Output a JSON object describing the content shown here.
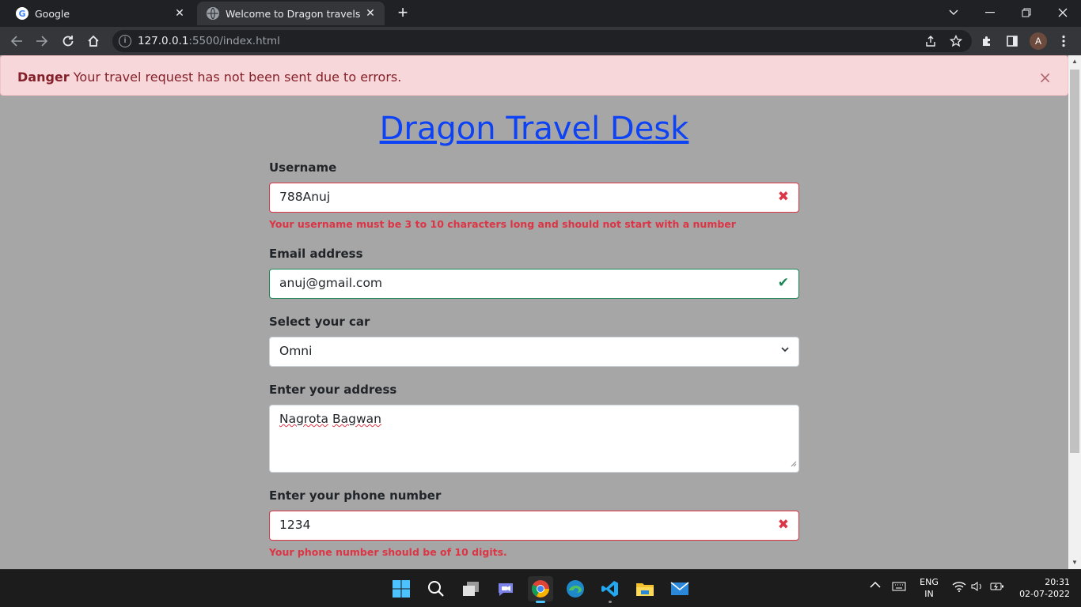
{
  "browser": {
    "tabs": [
      {
        "title": "Google",
        "favicon": "G"
      },
      {
        "title": "Welcome to Dragon travels",
        "favicon": "globe"
      }
    ],
    "tab_close": "✕",
    "new_tab": "+",
    "url_host": "127.0.0.1",
    "url_rest": ":5500/index.html",
    "profile_initial": "A"
  },
  "alert": {
    "strong": "Danger",
    "message": " Your travel request has not been sent due to errors.",
    "close": "×"
  },
  "page": {
    "heading": "Dragon Travel Desk",
    "username": {
      "label": "Username",
      "value": "788Anuj",
      "state": "✖",
      "feedback": "Your username must be 3 to 10 characters long and should not start with a number"
    },
    "email": {
      "label": "Email address",
      "value": "anuj@gmail.com",
      "state": "✔"
    },
    "car": {
      "label": "Select your car",
      "value": "Omni"
    },
    "address": {
      "label": "Enter your address",
      "value_word1": "Nagrota",
      "value_word2": "Bagwan"
    },
    "phone": {
      "label": "Enter your phone number",
      "value": "1234",
      "state": "✖",
      "feedback": "Your phone number should be of 10 digits."
    }
  },
  "taskbar": {
    "lang_top": "ENG",
    "lang_bottom": "IN",
    "time": "20:31",
    "date": "02-07-2022"
  },
  "colors": {
    "invalid": "#dc3545",
    "valid": "#198754",
    "link": "#0d43f5",
    "alert_bg": "#f8d7da"
  }
}
